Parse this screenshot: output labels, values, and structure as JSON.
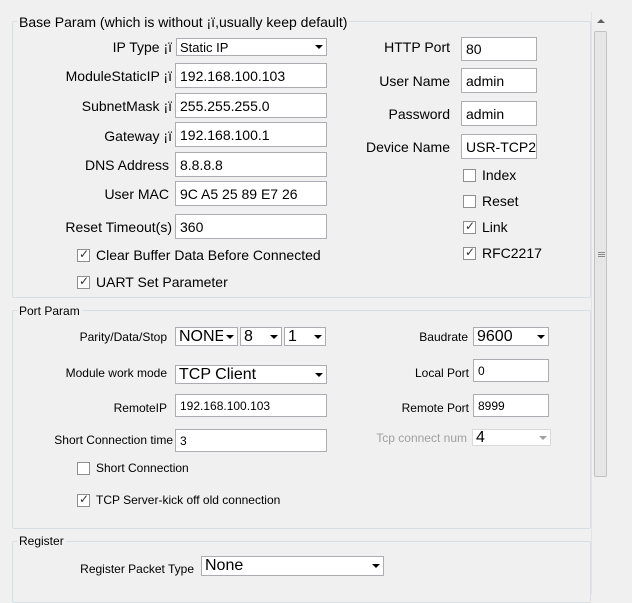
{
  "base_param": {
    "legend": "Base Param (which is without ¡ï,usually keep default)",
    "ip_type_label": "IP Type ¡ï",
    "ip_type_value": "Static IP",
    "static_ip_label": "ModuleStaticIP ¡ï",
    "static_ip_value": "192.168.100.103",
    "subnet_label": "SubnetMask ¡ï",
    "subnet_value": "255.255.255.0",
    "gateway_label": "Gateway ¡ï",
    "gateway_value": "192.168.100.1",
    "dns_label": "DNS Address",
    "dns_value": "8.8.8.8",
    "mac_label": "User MAC",
    "mac_value": "9C A5 25 89 E7 26",
    "reset_timeout_label": "Reset Timeout(s)",
    "reset_timeout_value": "360",
    "clear_buffer_label": "Clear Buffer Data Before Connected",
    "clear_buffer_checked": true,
    "uart_set_label": "UART Set Parameter",
    "uart_set_checked": true,
    "http_port_label": "HTTP Port",
    "http_port_value": "80",
    "username_label": "User Name",
    "username_value": "admin",
    "password_label": "Password",
    "password_value": "admin",
    "device_name_label": "Device Name",
    "device_name_value": "USR-TCP2",
    "index_label": "Index",
    "index_checked": false,
    "reset_label": "Reset",
    "reset_checked": false,
    "link_label": "Link",
    "link_checked": true,
    "rfc_label": "RFC2217",
    "rfc_checked": true
  },
  "port_param": {
    "legend": "Port Param",
    "parity_label": "Parity/Data/Stop",
    "parity_value": "NONE",
    "data_bits_value": "8",
    "stop_bits_value": "1",
    "baudrate_label": "Baudrate",
    "baudrate_value": "9600",
    "work_mode_label": "Module work mode",
    "work_mode_value": "TCP Client",
    "local_port_label": "Local Port",
    "local_port_value": "0",
    "remote_ip_label": "RemoteIP",
    "remote_ip_value": "192.168.100.103",
    "remote_port_label": "Remote Port",
    "remote_port_value": "8999",
    "short_conn_time_label": "Short Connection time",
    "short_conn_time_value": "3",
    "tcp_conn_num_label": "Tcp connect num",
    "tcp_conn_num_value": "4",
    "short_conn_label": "Short Connection",
    "short_conn_checked": false,
    "kick_off_label": "TCP Server-kick off old connection",
    "kick_off_checked": true
  },
  "register": {
    "legend": "Register",
    "packet_type_label": "Register Packet Type",
    "packet_type_value": "None"
  }
}
